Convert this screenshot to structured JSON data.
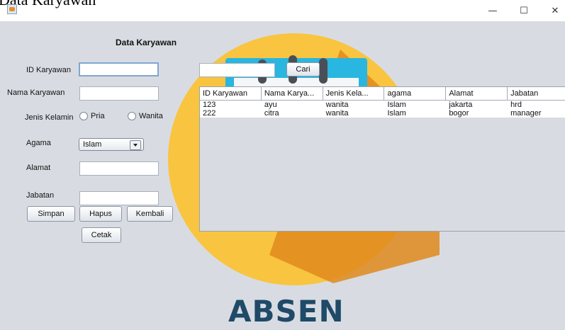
{
  "window": {
    "title": "Data Karyawan",
    "minimize_glyph": "—",
    "maximize_glyph": "☐",
    "close_glyph": "✕"
  },
  "form": {
    "heading": "Data Karyawan",
    "id_label": "ID Karyawan",
    "id_value": "",
    "nama_label": "Nama Karyawan",
    "nama_value": "",
    "jenis_label": "Jenis Kelamin",
    "radio_pria": "Pria",
    "radio_wanita": "Wanita",
    "agama_label": "Agama",
    "agama_value": "Islam",
    "alamat_label": "Alamat",
    "alamat_value": "",
    "jabatan_label": "Jabatan",
    "jabatan_value": ""
  },
  "buttons": {
    "simpan": "Simpan",
    "hapus": "Hapus",
    "kembali": "Kembali",
    "cetak": "Cetak",
    "cari": "Cari"
  },
  "search": {
    "value": ""
  },
  "table": {
    "columns": [
      "ID Karyawan",
      "Nama Karya...",
      "Jenis Kela...",
      "agama",
      "Alamat",
      "Jabatan"
    ],
    "rows": [
      [
        "123",
        "ayu",
        "wanita",
        "Islam",
        "jakarta",
        "hrd"
      ],
      [
        "222",
        "citra",
        "wanita",
        "Islam",
        "bogor",
        "manager"
      ]
    ]
  },
  "background": {
    "logo_text": "ABSEN",
    "accent_color": "#f9c440",
    "teal_color": "#29b6e0",
    "navy_color": "#1f4a68"
  }
}
